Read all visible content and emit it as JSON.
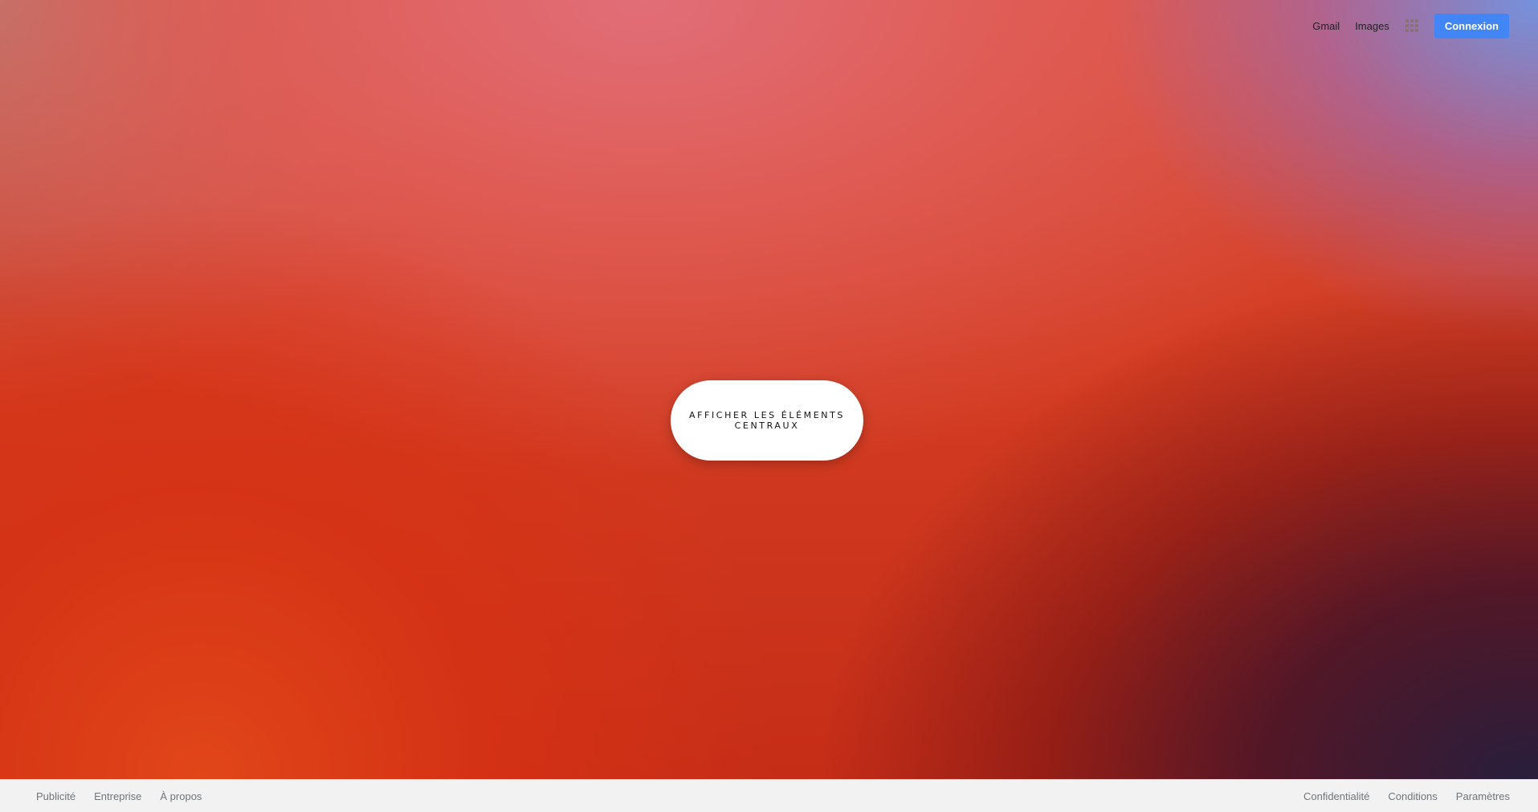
{
  "header": {
    "links": [
      "Gmail",
      "Images"
    ],
    "apps_icon": "apps-grid-icon",
    "signin_label": "Connexion"
  },
  "center": {
    "button_label": "AFFICHER LES ÉLÉMENTS CENTRAUX"
  },
  "footer": {
    "left": [
      "Publicité",
      "Entreprise",
      "À propos"
    ],
    "right": [
      "Confidentialité",
      "Conditions",
      "Paramètres"
    ]
  },
  "colors": {
    "signin_bg": "#4285f4",
    "footer_bg": "#f2f2f2",
    "footer_text": "#70757a"
  }
}
